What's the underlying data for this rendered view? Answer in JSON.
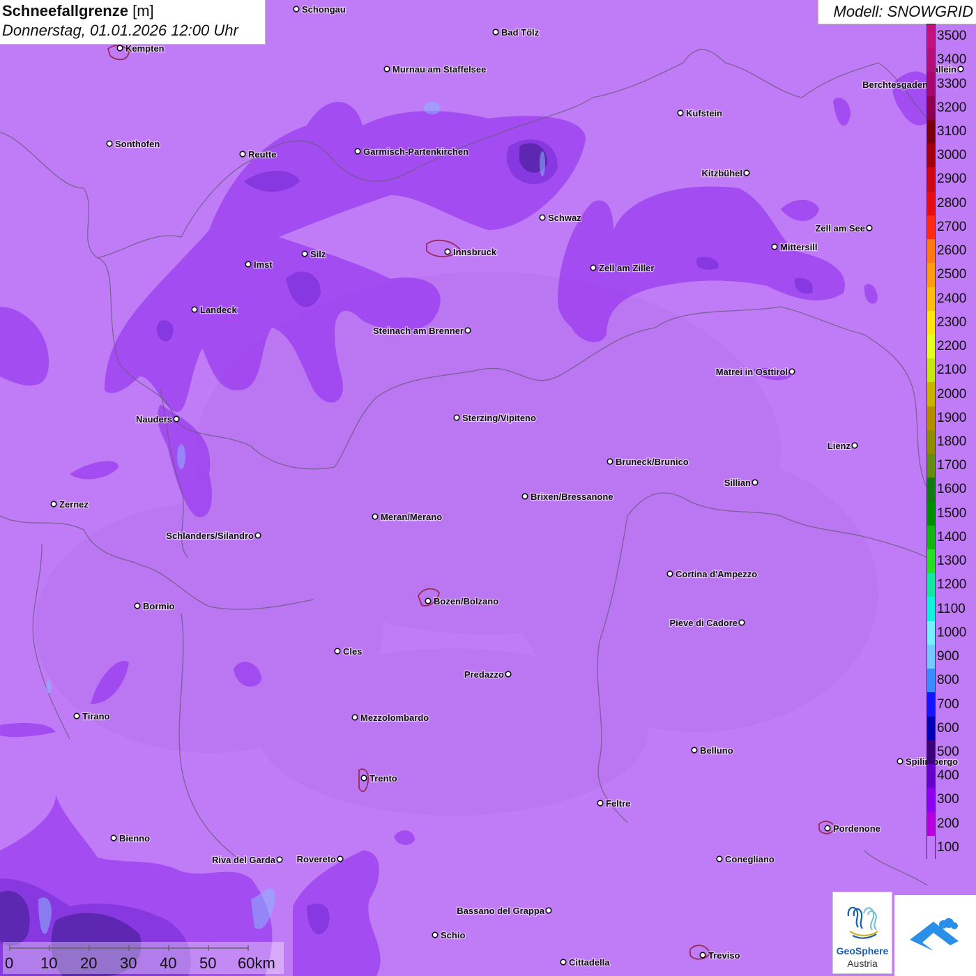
{
  "title": {
    "label_bold": "Schneefallgrenze",
    "unit": "[m]",
    "datetime": "Donnerstag, 01.01.2026 12:00 Uhr"
  },
  "model": "Modell: SNOWGRID",
  "legend": {
    "levels": [
      {
        "value": "3500",
        "color": "#c2127e"
      },
      {
        "value": "3400",
        "color": "#b40e78"
      },
      {
        "value": "3300",
        "color": "#a5086e"
      },
      {
        "value": "3200",
        "color": "#8e0050"
      },
      {
        "value": "3100",
        "color": "#7a0010"
      },
      {
        "value": "3000",
        "color": "#a00010"
      },
      {
        "value": "2900",
        "color": "#c80814"
      },
      {
        "value": "2800",
        "color": "#e50c14"
      },
      {
        "value": "2700",
        "color": "#ff2a14"
      },
      {
        "value": "2600",
        "color": "#ff7a14"
      },
      {
        "value": "2500",
        "color": "#ff9c14"
      },
      {
        "value": "2400",
        "color": "#ffbe14"
      },
      {
        "value": "2300",
        "color": "#ffe614"
      },
      {
        "value": "2200",
        "color": "#e6ff28"
      },
      {
        "value": "2100",
        "color": "#c8e614"
      },
      {
        "value": "2000",
        "color": "#c8b400"
      },
      {
        "value": "1900",
        "color": "#b48c00"
      },
      {
        "value": "1800",
        "color": "#8c8c00"
      },
      {
        "value": "1700",
        "color": "#648c14"
      },
      {
        "value": "1600",
        "color": "#147814"
      },
      {
        "value": "1500",
        "color": "#008c00"
      },
      {
        "value": "1400",
        "color": "#14b414"
      },
      {
        "value": "1300",
        "color": "#28dc28"
      },
      {
        "value": "1200",
        "color": "#14e6a0"
      },
      {
        "value": "1100",
        "color": "#14f0dc"
      },
      {
        "value": "1000",
        "color": "#78f0ff"
      },
      {
        "value": "900",
        "color": "#78c8ff"
      },
      {
        "value": "800",
        "color": "#3c8cff"
      },
      {
        "value": "700",
        "color": "#1414ff"
      },
      {
        "value": "600",
        "color": "#0000b4"
      },
      {
        "value": "500",
        "color": "#3c0078"
      },
      {
        "value": "400",
        "color": "#6400c8"
      },
      {
        "value": "300",
        "color": "#8c00f0"
      },
      {
        "value": "200",
        "color": "#b400dc"
      },
      {
        "value": "100",
        "color": "#c07cf6"
      }
    ]
  },
  "scale": {
    "ticks": [
      "0",
      "10",
      "20",
      "30",
      "40",
      "50",
      "60km"
    ]
  },
  "cities": [
    {
      "name": "Schongau"
    },
    {
      "name": "Bad Tölz"
    },
    {
      "name": "Kempten"
    },
    {
      "name": "Murnau am Staffelsee"
    },
    {
      "name": "Berchtesgaden"
    },
    {
      "name": "Kufstein"
    },
    {
      "name": "Sonthofen"
    },
    {
      "name": "Reutte"
    },
    {
      "name": "Garmisch-Partenkirchen"
    },
    {
      "name": "Kitzbühel"
    },
    {
      "name": "Schwaz"
    },
    {
      "name": "Zell am See"
    },
    {
      "name": "Innsbruck"
    },
    {
      "name": "Mittersill"
    },
    {
      "name": "Silz"
    },
    {
      "name": "Imst"
    },
    {
      "name": "Zell am Ziller"
    },
    {
      "name": "Landeck"
    },
    {
      "name": "Steinach am Brenner"
    },
    {
      "name": "Matrei in Osttirol"
    },
    {
      "name": "Nauders"
    },
    {
      "name": "Sterzing/Vipiteno"
    },
    {
      "name": "Lienz"
    },
    {
      "name": "Bruneck/Brunico"
    },
    {
      "name": "Sillian"
    },
    {
      "name": "Zernez"
    },
    {
      "name": "Brixen/Bressanone"
    },
    {
      "name": "Meran/Merano"
    },
    {
      "name": "Schlanders/Silandro"
    },
    {
      "name": "Cortina d'Ampezzo"
    },
    {
      "name": "Bozen/Bolzano"
    },
    {
      "name": "Bormio"
    },
    {
      "name": "Pieve di Cadore"
    },
    {
      "name": "Cles"
    },
    {
      "name": "Predazzo"
    },
    {
      "name": "Tirano"
    },
    {
      "name": "Mezzolombardo"
    },
    {
      "name": "Belluno"
    },
    {
      "name": "Spilimbergo"
    },
    {
      "name": "Trento"
    },
    {
      "name": "Feltre"
    },
    {
      "name": "Pordenone"
    },
    {
      "name": "Bienno"
    },
    {
      "name": "Riva del Garda"
    },
    {
      "name": "Rovereto"
    },
    {
      "name": "Conegliano"
    },
    {
      "name": "Bassano del Grappa"
    },
    {
      "name": "Schio"
    },
    {
      "name": "Treviso"
    },
    {
      "name": "Cittadella"
    },
    {
      "name": "Hallein"
    }
  ],
  "logos": {
    "geosphere_name": "GeoSphere",
    "geosphere_sub": "Austria"
  }
}
